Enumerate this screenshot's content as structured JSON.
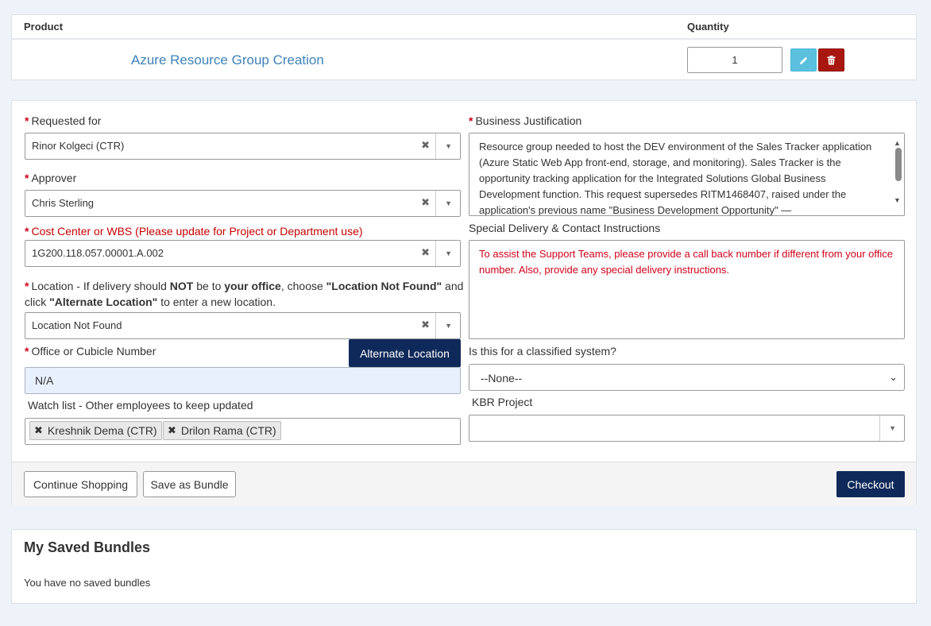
{
  "cart": {
    "col_product": "Product",
    "col_quantity": "Quantity",
    "item_name": "Azure Resource Group Creation",
    "quantity": "1"
  },
  "form": {
    "requested_for": {
      "label": "Requested for",
      "value": "Rinor Kolgeci (CTR)"
    },
    "approver": {
      "label": "Approver",
      "value": "Chris Sterling"
    },
    "cost_center": {
      "label": "Cost Center or WBS (Please update for Project or Department use)",
      "value": "1G200.118.057.00001.A.002"
    },
    "location": {
      "label_a": "Location - If delivery should ",
      "label_not": "NOT",
      "label_b": " be to ",
      "label_office": "your office",
      "label_c": ", choose ",
      "label_lnf": "\"Location Not Found\"",
      "label_d": " and",
      "label_e": "click ",
      "label_alt": "\"Alternate Location\"",
      "label_f": " to enter a new location.",
      "value": "Location Not Found"
    },
    "office": {
      "label": "Office or Cubicle Number",
      "value": "N/A",
      "alt_button": "Alternate Location"
    },
    "watch_list": {
      "label": "Watch list - Other employees to keep updated",
      "tags": [
        "Kreshnik Dema (CTR)",
        "Drilon Rama (CTR)"
      ]
    },
    "business_justification": {
      "label": "Business Justification",
      "value": "Resource group needed to host the DEV environment of the Sales Tracker application (Azure Static Web App front-end, storage, and monitoring). Sales Tracker is the opportunity tracking application for the Integrated Solutions Global Business Development function. This request supersedes RITM1468407, raised under the application's previous name \"Business Development Opportunity\" —"
    },
    "special_delivery": {
      "label": "Special Delivery & Contact Instructions",
      "placeholder": "To assist the Support Teams, please provide a call back number if different from your office number. Also, provide any special delivery instructions."
    },
    "classified": {
      "label": "Is this for a classified system?",
      "value": "--None--"
    },
    "kbr_project": {
      "label": "KBR Project",
      "value": ""
    }
  },
  "footer": {
    "continue_shopping": "Continue Shopping",
    "save_bundle": "Save as Bundle",
    "checkout": "Checkout"
  },
  "bundles": {
    "title": "My Saved Bundles",
    "empty": "You have no saved bundles"
  },
  "colors": {
    "accent_navy": "#0f2a5a",
    "link": "#3e82b8",
    "required": "#d0021b",
    "delete": "#a81811",
    "edit": "#5bc0de"
  }
}
